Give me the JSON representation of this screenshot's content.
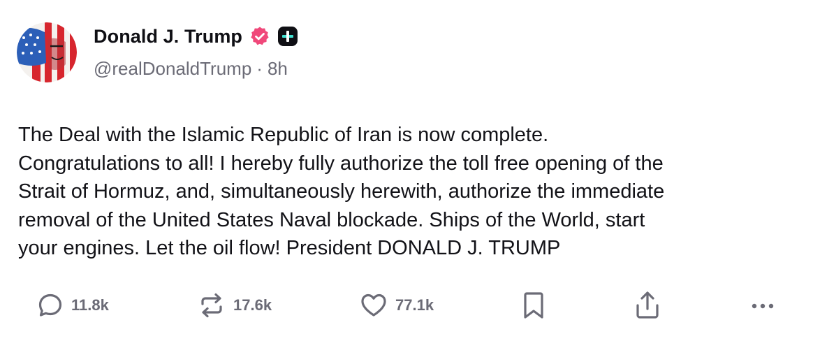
{
  "author": {
    "display_name": "Donald J. Trump",
    "handle": "@realDonaldTrump",
    "separator": "·",
    "time_ago": "8h",
    "verified_badge_icon": "verified-badge-icon",
    "plus_badge_icon": "plus-badge-icon"
  },
  "post": {
    "text": "The Deal with the Islamic Republic of Iran is now complete.\nCongratulations to all! I hereby fully authorize the toll free opening of the\nStrait of Hormuz, and, simultaneously herewith, authorize the immediate\nremoval of the United States Naval blockade. Ships of the World, start\nyour engines. Let the oil flow! President DONALD J. TRUMP"
  },
  "actions": {
    "replies": {
      "icon": "reply-icon",
      "count": "11.8k"
    },
    "reposts": {
      "icon": "repost-icon",
      "count": "17.6k"
    },
    "likes": {
      "icon": "heart-icon",
      "count": "77.1k"
    },
    "bookmark": {
      "icon": "bookmark-icon"
    },
    "share": {
      "icon": "share-icon"
    },
    "more": {
      "icon": "more-icon"
    }
  },
  "colors": {
    "text": "#121217",
    "muted": "#6b6b76",
    "verified": "#f0487a",
    "plus_badge_bg": "#0f0f14",
    "plus_badge_fg": "#40e0d0",
    "icon": "#6b6b76"
  }
}
